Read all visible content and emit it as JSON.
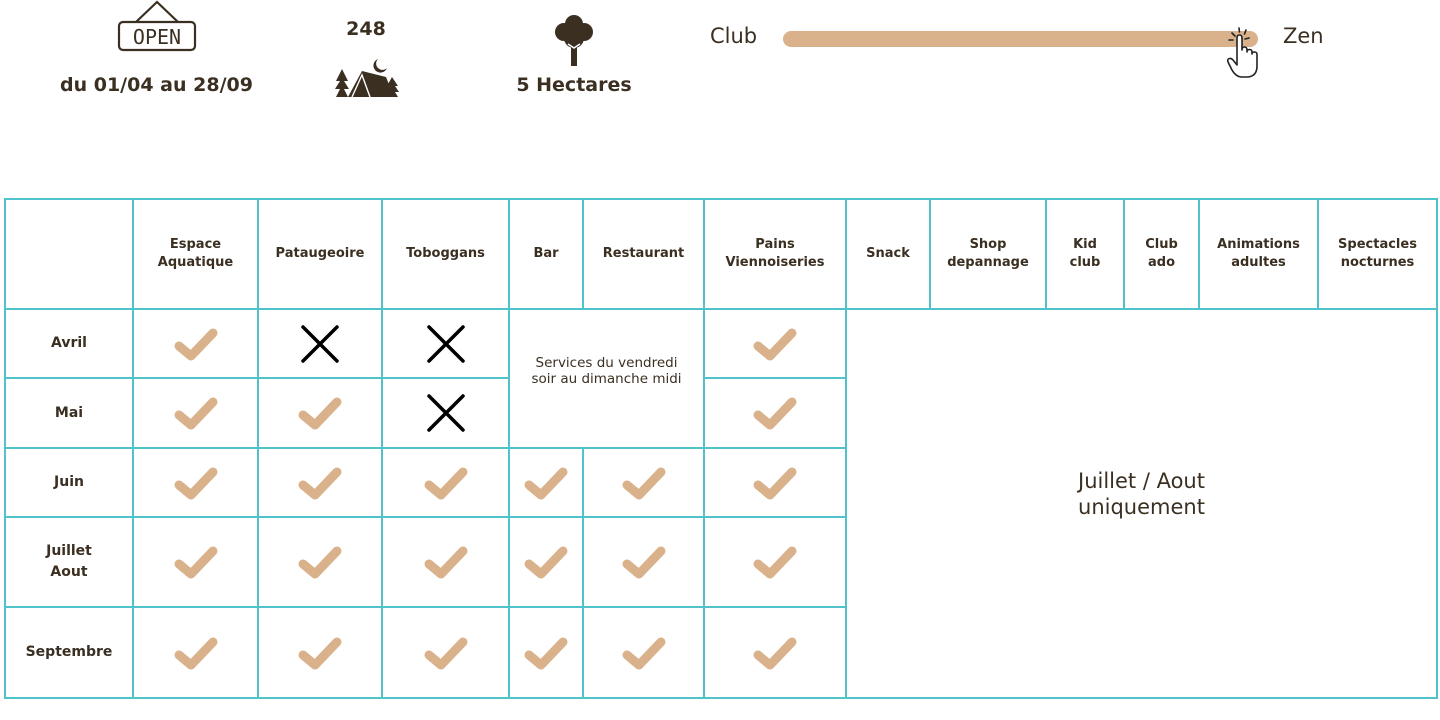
{
  "info": {
    "open_sign": "OPEN",
    "open_icon": "open-sign-icon",
    "dates": "du 01/04 au 28/09",
    "pitches_count": "248",
    "pitches_icon": "tent-camp-icon",
    "area_icon": "tree-icon",
    "area": "5 Hectares"
  },
  "ambience_slider": {
    "left_label": "Club",
    "right_label": "Zen",
    "value_percent": 96,
    "cursor_icon": "pointing-hand-cursor-icon",
    "track_color": "#d9b28b"
  },
  "colors": {
    "grid_border": "#4fc3c9",
    "check": "#d9b28b",
    "cross": "#000000",
    "text": "#3b2f22"
  },
  "table": {
    "columns": [
      "",
      "Espace\nAquatique",
      "Pataugeoire",
      "Toboggans",
      "Bar",
      "Restaurant",
      "Pains\nViennoiseries",
      "Snack",
      "Shop\ndepannage",
      "Kid\nclub",
      "Club\nado",
      "Animations\nadultes",
      "Spectacles\nnocturnes"
    ],
    "rows": [
      {
        "month": "Avril",
        "espace_aquatique": "yes",
        "pataugeoire": "no",
        "toboggans": "no",
        "pains_viennoiseries": "yes"
      },
      {
        "month": "Mai",
        "espace_aquatique": "yes",
        "pataugeoire": "yes",
        "toboggans": "no",
        "pains_viennoiseries": "yes"
      },
      {
        "month": "Juin",
        "espace_aquatique": "yes",
        "pataugeoire": "yes",
        "toboggans": "yes",
        "bar": "yes",
        "restaurant": "yes",
        "pains_viennoiseries": "yes"
      },
      {
        "month": "Juillet\nAout",
        "espace_aquatique": "yes",
        "pataugeoire": "yes",
        "toboggans": "yes",
        "bar": "yes",
        "restaurant": "yes",
        "pains_viennoiseries": "yes"
      },
      {
        "month": "Septembre",
        "espace_aquatique": "yes",
        "pataugeoire": "yes",
        "toboggans": "yes",
        "bar": "yes",
        "restaurant": "yes",
        "pains_viennoiseries": "yes"
      }
    ],
    "bar_restaurant_avril_mai_note": "Services du vendredi\nsoir au dimanche midi",
    "summer_only_note": "Juillet / Aout\nuniquement"
  }
}
